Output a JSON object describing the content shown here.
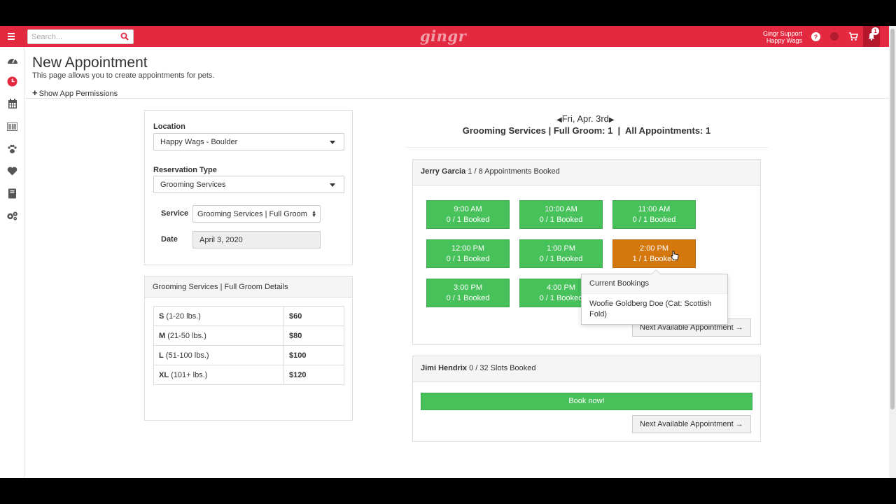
{
  "topbar": {
    "search_placeholder": "Search...",
    "logo": "gingr",
    "user_name": "Gingr Support",
    "user_location": "Happy Wags",
    "notification_count": "1",
    "brand_color": "#e2293f"
  },
  "sidebar": {
    "icons": [
      "dashboard-icon",
      "clock-icon",
      "calendar-icon",
      "barcode-icon",
      "paw-icon",
      "heart-icon",
      "book-icon",
      "settings-icon"
    ]
  },
  "page": {
    "title": "New Appointment",
    "subtitle": "This page allows you to create appointments for pets.",
    "permissions_link": "Show App Permissions"
  },
  "form": {
    "location_label": "Location",
    "location_value": "Happy Wags - Boulder",
    "reservation_type_label": "Reservation Type",
    "reservation_type_value": "Grooming Services",
    "service_label": "Service",
    "service_value": "Grooming Services | Full Groom",
    "date_label": "Date",
    "date_value": "April 3, 2020"
  },
  "details": {
    "title": "Grooming Services | Full Groom Details",
    "rows": [
      {
        "size": "S",
        "range": "(1-20 lbs.)",
        "price": "$60"
      },
      {
        "size": "M",
        "range": "(21-50 lbs.)",
        "price": "$80"
      },
      {
        "size": "L",
        "range": "(51-100 lbs.)",
        "price": "$100"
      },
      {
        "size": "XL",
        "range": "(101+ lbs.)",
        "price": "$120"
      }
    ]
  },
  "schedule": {
    "day": "Fri, Apr. 3rd",
    "summary": "Grooming Services | Full Groom: 1  |  All Appointments: 1",
    "groomers": [
      {
        "name": "Jerry Garcia",
        "booked": "1 / 8 Appointments Booked",
        "slots": [
          {
            "time": "9:00 AM",
            "status": "0 / 1 Booked"
          },
          {
            "time": "10:00 AM",
            "status": "0 / 1 Booked"
          },
          {
            "time": "11:00 AM",
            "status": "0 / 1 Booked"
          },
          {
            "time": "12:00 PM",
            "status": "0 / 1 Booked"
          },
          {
            "time": "1:00 PM",
            "status": "0 / 1 Booked"
          },
          {
            "time": "2:00 PM",
            "status": "1 / 1 Booked"
          },
          {
            "time": "3:00 PM",
            "status": "0 / 1 Booked"
          },
          {
            "time": "4:00 PM",
            "status": "0 / 1 Booked"
          }
        ],
        "next_button": "Next Available Appointment"
      },
      {
        "name": "Jimi Hendrix",
        "booked": "0 / 32 Slots Booked",
        "book_button": "Book now!",
        "next_button": "Next Available Appointment"
      }
    ],
    "tooltip": {
      "title": "Current Bookings",
      "entry": "Woofie Goldberg Doe (Cat: Scottish Fold)"
    },
    "available_color": "#47c25a",
    "booked_color": "#d4770d"
  }
}
